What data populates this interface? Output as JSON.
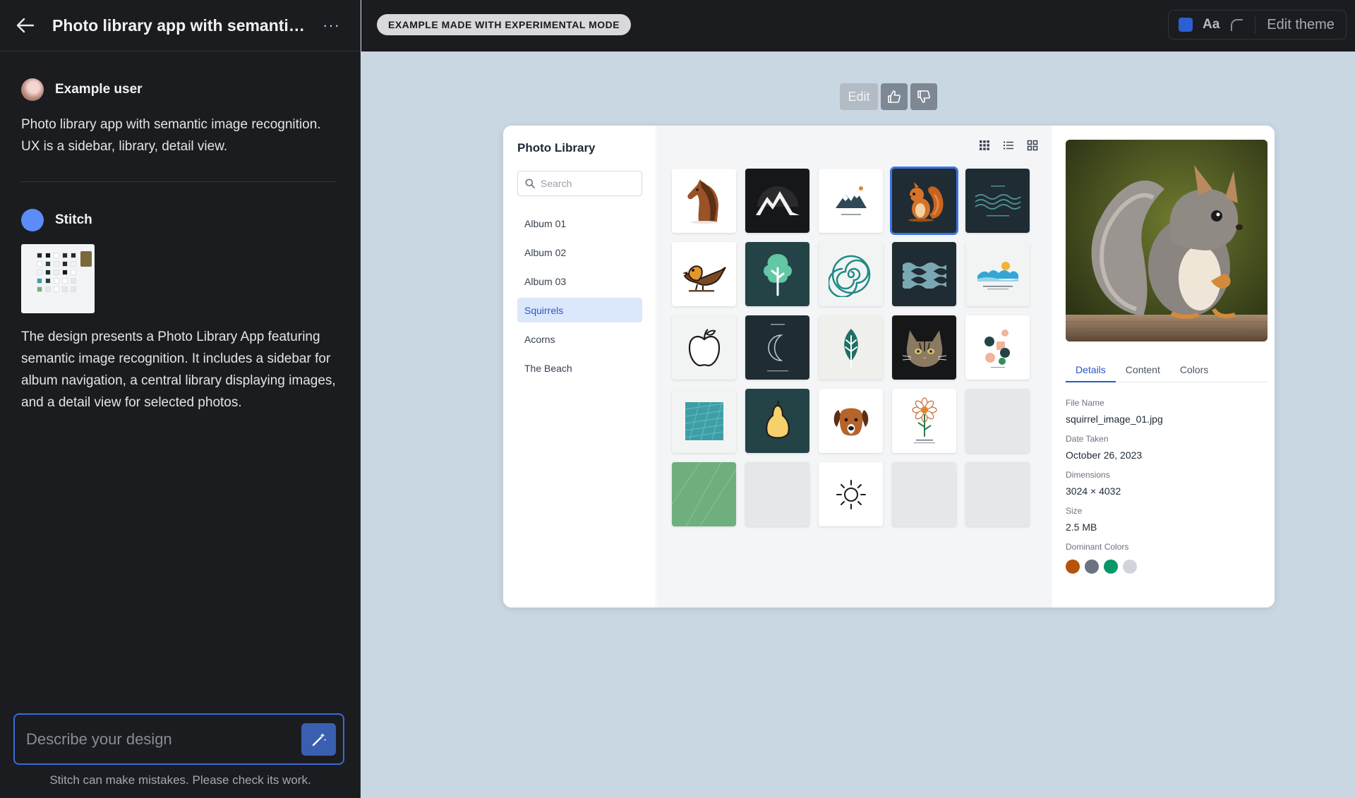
{
  "header": {
    "title": "Photo library app with semantic image recognition"
  },
  "chat": {
    "user": {
      "name": "Example user",
      "text": "Photo library app with semantic image recognition. UX is a sidebar, library, detail view."
    },
    "assistant": {
      "name": "Stitch",
      "text": "The design presents a Photo Library App featuring semantic image recognition. It includes a sidebar for album navigation, a central library displaying images, and a detail view for selected photos."
    }
  },
  "composer": {
    "placeholder": "Describe your design",
    "disclaimer": "Stitch can make mistakes. Please check its work."
  },
  "topbar": {
    "badge": "EXAMPLE MADE WITH EXPERIMENTAL MODE",
    "font_sample": "Aa",
    "edit_theme": "Edit theme",
    "theme_color": "#2c5fd1"
  },
  "canvas": {
    "edit_label": "Edit"
  },
  "app": {
    "title": "Photo Library",
    "search_placeholder": "Search",
    "albums": [
      "Album 01",
      "Album 02",
      "Album 03",
      "Squirrels",
      "Acorns",
      "The Beach"
    ],
    "active_album": "Squirrels",
    "detail": {
      "tabs": [
        "Details",
        "Content",
        "Colors"
      ],
      "active_tab": "Details",
      "file_name_label": "File Name",
      "file_name": "squirrel_image_01.jpg",
      "date_label": "Date Taken",
      "date": "October 26, 2023",
      "dimensions_label": "Dimensions",
      "dimensions": "3024 × 4032",
      "size_label": "Size",
      "size": "2.5 MB",
      "colors_label": "Dominant Colors",
      "dominant_colors": [
        "#b45309",
        "#6b7280",
        "#059669",
        "#d1d5db"
      ]
    },
    "photos": [
      "horse",
      "mountain-arch",
      "mountain-logo",
      "squirrel",
      "waves",
      "bird",
      "tree",
      "spiral",
      "wave-pattern",
      "beach-wave",
      "apple",
      "moon-crescent",
      "leaf",
      "cat",
      "abstract-shapes",
      "teal-texture",
      "pear",
      "dog",
      "flower",
      "blank",
      "green-texture",
      "blank",
      "sun",
      "blank",
      "blank"
    ]
  }
}
